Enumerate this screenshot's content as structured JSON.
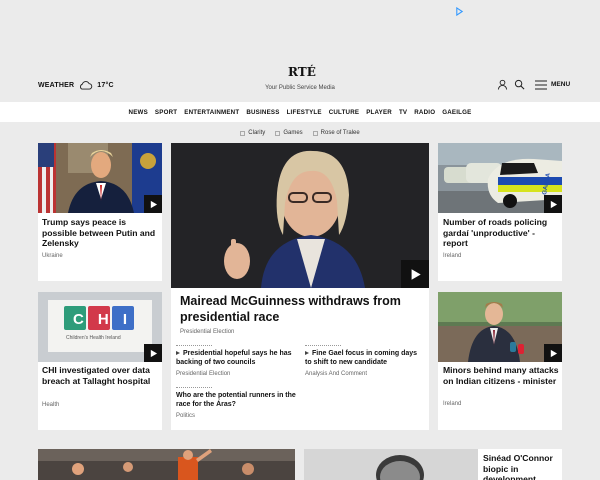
{
  "header": {
    "weather_label": "WEATHER",
    "temperature": "17°C",
    "logo": "RTÉ",
    "tagline": "Your Public Service Media",
    "menu_label": "MENU"
  },
  "nav": [
    "NEWS",
    "SPORT",
    "ENTERTAINMENT",
    "BUSINESS",
    "LIFESTYLE",
    "CULTURE",
    "PLAYER",
    "TV",
    "RADIO",
    "GAEILGE"
  ],
  "subnav": [
    "Clarity",
    "Games",
    "Rose of Tralee"
  ],
  "stories": {
    "trump": {
      "title": "Trump says peace is possible between Putin and Zelensky",
      "category": "Ukraine"
    },
    "hero": {
      "title": "Mairead McGuinness withdraws from presidential race",
      "category": "Presidential Election"
    },
    "roads": {
      "title": "Number of roads policing gardaí 'unproductive' - report",
      "category": "Ireland"
    },
    "chi": {
      "title": "CHI investigated over data breach at Tallaght hospital",
      "category": "Health"
    },
    "attacks": {
      "title": "Minors behind many attacks on Indian citizens - minister",
      "category": "Ireland"
    },
    "sub1": {
      "title": "Presidential hopeful says he has backing of two councils",
      "category": "Presidential Election"
    },
    "sub2": {
      "title": "Fine Gael focus in coming days to shift to new candidate",
      "category": "Analysis And Comment"
    },
    "sub3": {
      "title": "Who are the potential runners in the race for the Áras?",
      "category": "Politics"
    },
    "sinead": {
      "title": "Sinéad O'Connor biopic in development"
    }
  },
  "thumb_text": {
    "chi_logo": "CHI",
    "chi_name": "Children's Health Ireland",
    "garda": "GARDA"
  },
  "colors": {
    "accent": "#111111",
    "background": "#ebebeb",
    "card": "#ffffff"
  }
}
